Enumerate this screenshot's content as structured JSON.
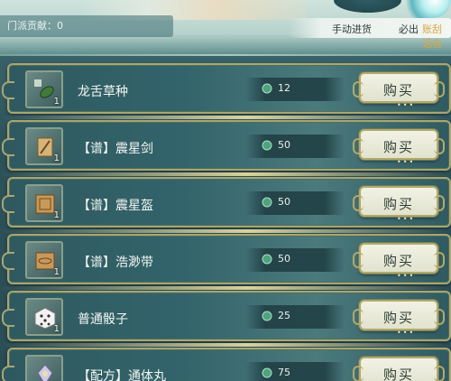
{
  "header": {
    "contribution_label": "门派贡献：0",
    "manual_restock_label": "手动进货",
    "must_label": "必出",
    "gold_label": "账刮话自"
  },
  "items": [
    {
      "name": "龙舌草种",
      "count": "1",
      "price": "12",
      "icon": "seed-icon",
      "buy_label": "购买"
    },
    {
      "name": "【谱】震星剑",
      "count": "1",
      "price": "50",
      "icon": "scroll-sword-icon",
      "buy_label": "购买"
    },
    {
      "name": "【谱】震星盔",
      "count": "1",
      "price": "50",
      "icon": "scroll-helmet-icon",
      "buy_label": "购买"
    },
    {
      "name": "【谱】浩渺带",
      "count": "1",
      "price": "50",
      "icon": "scroll-belt-icon",
      "buy_label": "购买"
    },
    {
      "name": "普通骰子",
      "count": "1",
      "price": "25",
      "icon": "dice-icon",
      "buy_label": "购买"
    },
    {
      "name": "【配方】通体丸",
      "count": "1",
      "price": "75",
      "icon": "recipe-pill-icon",
      "buy_label": "购买"
    }
  ],
  "colors": {
    "row_border": "#a9a672",
    "buy_button_bg": "#f1f2e4",
    "text": "#f2f6f2"
  }
}
